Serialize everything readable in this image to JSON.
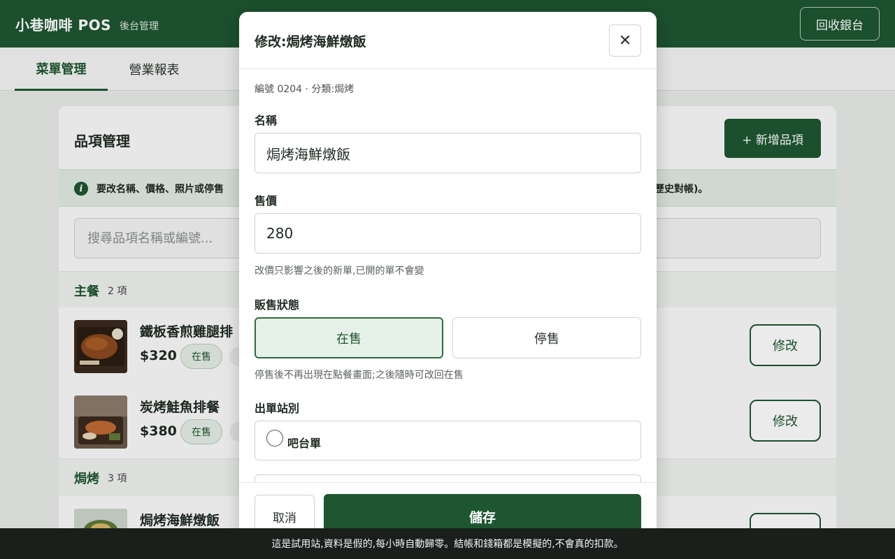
{
  "header": {
    "brand": "小巷咖啡 POS",
    "subtitle": "後台管理",
    "back_button": "回收銀台"
  },
  "tabs": [
    {
      "label": "菜單管理",
      "active": true
    },
    {
      "label": "營業報表",
      "active": false
    }
  ],
  "panel": {
    "title": "品項管理",
    "add_button": "+ 新增品項",
    "notice_start": "要改名稱、價格、照片或停售",
    "notice_end": "歷史對帳)。",
    "search_placeholder": "搜尋品項名稱或編號...",
    "sections": [
      {
        "name": "主餐",
        "count": "2 項"
      },
      {
        "name": "焗烤",
        "count": "3 項"
      }
    ],
    "items": [
      {
        "name": "鐵板香煎雞腿排",
        "price": "$320",
        "badge": "在售",
        "edit": "修改"
      },
      {
        "name": "炭烤鮭魚排餐",
        "price": "$380",
        "badge": "在售",
        "edit": "修改"
      },
      {
        "name": "焗烤海鮮燉飯"
      }
    ]
  },
  "modal": {
    "title": "修改:焗烤海鮮燉飯",
    "meta": "編號 0204 · 分類:焗烤",
    "name_label": "名稱",
    "name_value": "焗烤海鮮燉飯",
    "price_label": "售價",
    "price_value": "280",
    "price_hint": "改價只影響之後的新單,已開的單不會變",
    "status_label": "販售狀態",
    "status_on": "在售",
    "status_off": "停售",
    "status_hint": "停售後不再出現在點餐畫面;之後隨時可改回在售",
    "station_label": "出單站別",
    "station_option": "吧台單",
    "cancel": "取消",
    "save": "儲存"
  },
  "demo_notice": "這是試用站,資料是假的,每小時自動歸零。結帳和錢箱都是模擬的,不會真的扣款。",
  "colors": {
    "brand": "#1e5631",
    "active_bg": "#e6f1e8",
    "demo_bar": "#1b1f1c"
  }
}
